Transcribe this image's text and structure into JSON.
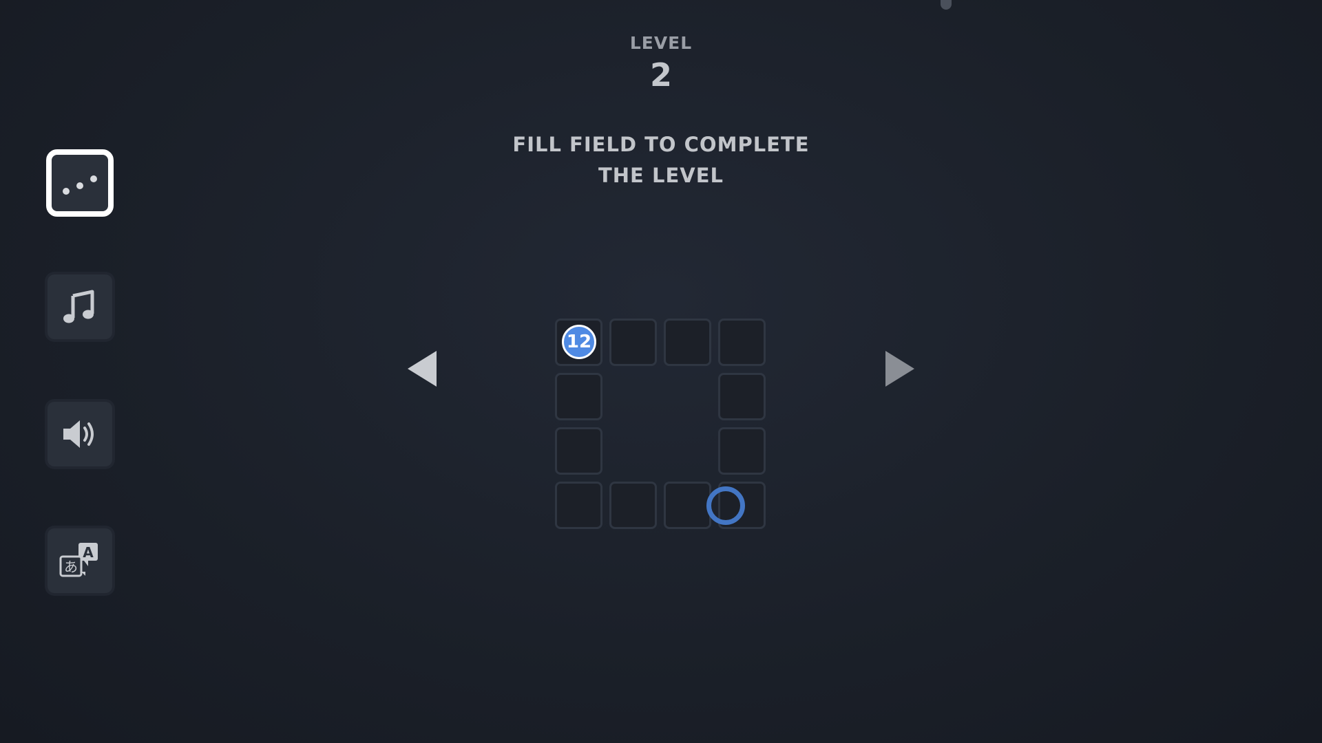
{
  "header": {
    "level_label": "LEVEL",
    "level_number": "2"
  },
  "instruction": "FILL FIELD TO COMPLETE THE LEVEL",
  "sidebar": {
    "items": [
      {
        "name": "theme-dots",
        "icon": "dots-pattern-icon",
        "selected": true
      },
      {
        "name": "music",
        "icon": "music-note-icon",
        "selected": false
      },
      {
        "name": "sound",
        "icon": "speaker-icon",
        "selected": false
      },
      {
        "name": "language",
        "icon": "translate-icon",
        "selected": false
      }
    ]
  },
  "navigation": {
    "prev_icon": "triangle-left-icon",
    "next_icon": "triangle-right-icon"
  },
  "board": {
    "rows": 4,
    "cols": 4,
    "shape": "ring",
    "start_value": "12",
    "colors": {
      "node": "#4f8ae3",
      "cursor": "#4376c4",
      "cell_border": "#2f3642"
    }
  }
}
